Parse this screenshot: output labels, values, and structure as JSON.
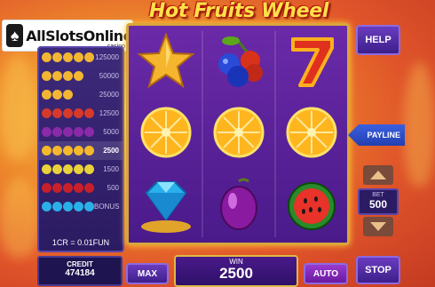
{
  "logo": {
    "text": "AllSlotsOnline",
    "sub": ".casino"
  },
  "title": "Hot Fruits Wheel",
  "paytable": {
    "rows": [
      {
        "symbol": "star",
        "count": 5,
        "value": "125000",
        "color": "#f2b632"
      },
      {
        "symbol": "star",
        "count": 4,
        "value": "50000",
        "color": "#f2b632"
      },
      {
        "symbol": "star",
        "count": 3,
        "value": "25000",
        "color": "#f2b632"
      },
      {
        "symbol": "seven",
        "count": 5,
        "value": "12500",
        "color": "#d83a2a"
      },
      {
        "symbol": "plum",
        "count": 5,
        "value": "5000",
        "color": "#8a2aa8"
      },
      {
        "symbol": "orange",
        "count": 5,
        "value": "2500",
        "color": "#f5b82a"
      },
      {
        "symbol": "lemon",
        "count": 5,
        "value": "1500",
        "color": "#e8d23a"
      },
      {
        "symbol": "cherry",
        "count": 5,
        "value": "500",
        "color": "#c8202a"
      },
      {
        "symbol": "diamond",
        "count": 5,
        "value": "BONUS",
        "color": "#2ab0e8"
      }
    ],
    "highlighted_value": "2500",
    "rate": "1CR = 0.01FUN"
  },
  "reels": [
    [
      "star-icon",
      "orange-slice-icon",
      "diamond-icon"
    ],
    [
      "blueberry-cherry-icon",
      "orange-slice-icon",
      "plum-icon"
    ],
    [
      "seven-icon",
      "orange-slice-icon",
      "watermelon-icon"
    ]
  ],
  "controls": {
    "help": "HELP",
    "payline": "PAYLINE",
    "bet_label": "BET",
    "bet_value": "500",
    "stop": "STOP",
    "max": "MAX",
    "auto": "AUTO"
  },
  "credit": {
    "label": "CREDIT",
    "value": "474184"
  },
  "win": {
    "label": "WIN",
    "value": "2500"
  }
}
